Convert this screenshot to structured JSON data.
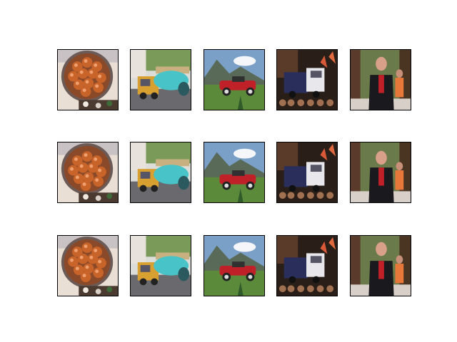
{
  "figure": {
    "background": "#ffffff",
    "frame_color": "#000000",
    "rows": 3,
    "cols": 5
  },
  "grid": [
    [
      {
        "subject": "bowl-of-oranges"
      },
      {
        "subject": "truck-with-cyan-blob"
      },
      {
        "subject": "red-classic-car"
      },
      {
        "subject": "garbage-truck-crowd"
      },
      {
        "subject": "man-in-dark-suit"
      }
    ],
    [
      {
        "subject": "bowl-of-oranges"
      },
      {
        "subject": "truck-with-cyan-blob"
      },
      {
        "subject": "red-classic-car"
      },
      {
        "subject": "garbage-truck-crowd"
      },
      {
        "subject": "man-in-dark-suit"
      }
    ],
    [
      {
        "subject": "bowl-of-oranges"
      },
      {
        "subject": "truck-with-cyan-blob"
      },
      {
        "subject": "red-classic-car"
      },
      {
        "subject": "garbage-truck-crowd"
      },
      {
        "subject": "man-in-dark-suit"
      }
    ]
  ]
}
